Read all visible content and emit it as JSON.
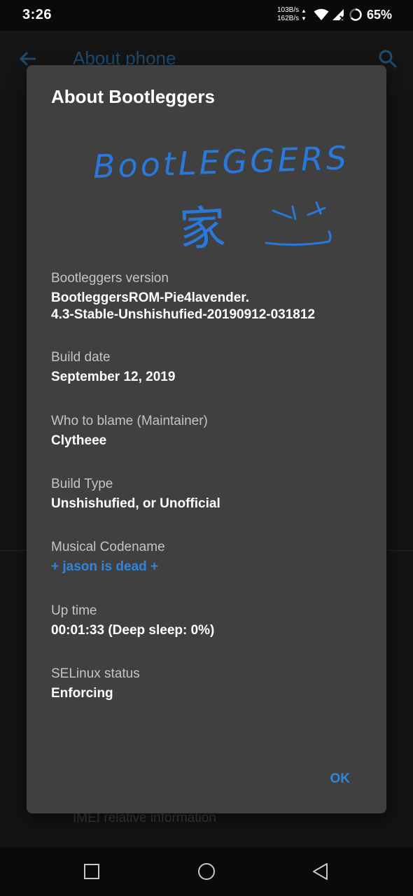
{
  "status_bar": {
    "time": "3:26",
    "speed_up": "103B/s",
    "speed_down": "162B/s",
    "battery": "65%",
    "icons": [
      "wifi-icon",
      "signal-icon",
      "battery-ring-icon"
    ]
  },
  "background_app": {
    "title": "About phone",
    "back_icon": "back-arrow-icon",
    "search_icon": "search-icon",
    "imei_item": "IMEI relative information"
  },
  "dialog": {
    "title": "About Bootleggers",
    "logo": {
      "text": "BootLEGGERS",
      "glyph": "家"
    },
    "items": [
      {
        "label": "Bootleggers version",
        "value": "BootleggersROM-Pie4lavender.\n4.3-Stable-Unshishufied-20190912-031812"
      },
      {
        "label": "Build date",
        "value": "September 12, 2019"
      },
      {
        "label": "Who to blame (Maintainer)",
        "value": "Clytheee"
      },
      {
        "label": "Build Type",
        "value": "Unshishufied, or Unofficial"
      },
      {
        "label": "Musical Codename",
        "value": "+ jason is dead +"
      },
      {
        "label": "Up time",
        "value": "00:01:33 (Deep sleep: 0%)"
      },
      {
        "label": "SELinux status",
        "value": "Enforcing"
      }
    ],
    "ok_label": "OK"
  },
  "colors": {
    "accent": "#2f86dc",
    "dialog_bg": "#404040",
    "logo": "#2a78d8"
  },
  "navbar": {
    "icons": [
      "recents-square-icon",
      "home-circle-icon",
      "back-triangle-icon"
    ]
  }
}
